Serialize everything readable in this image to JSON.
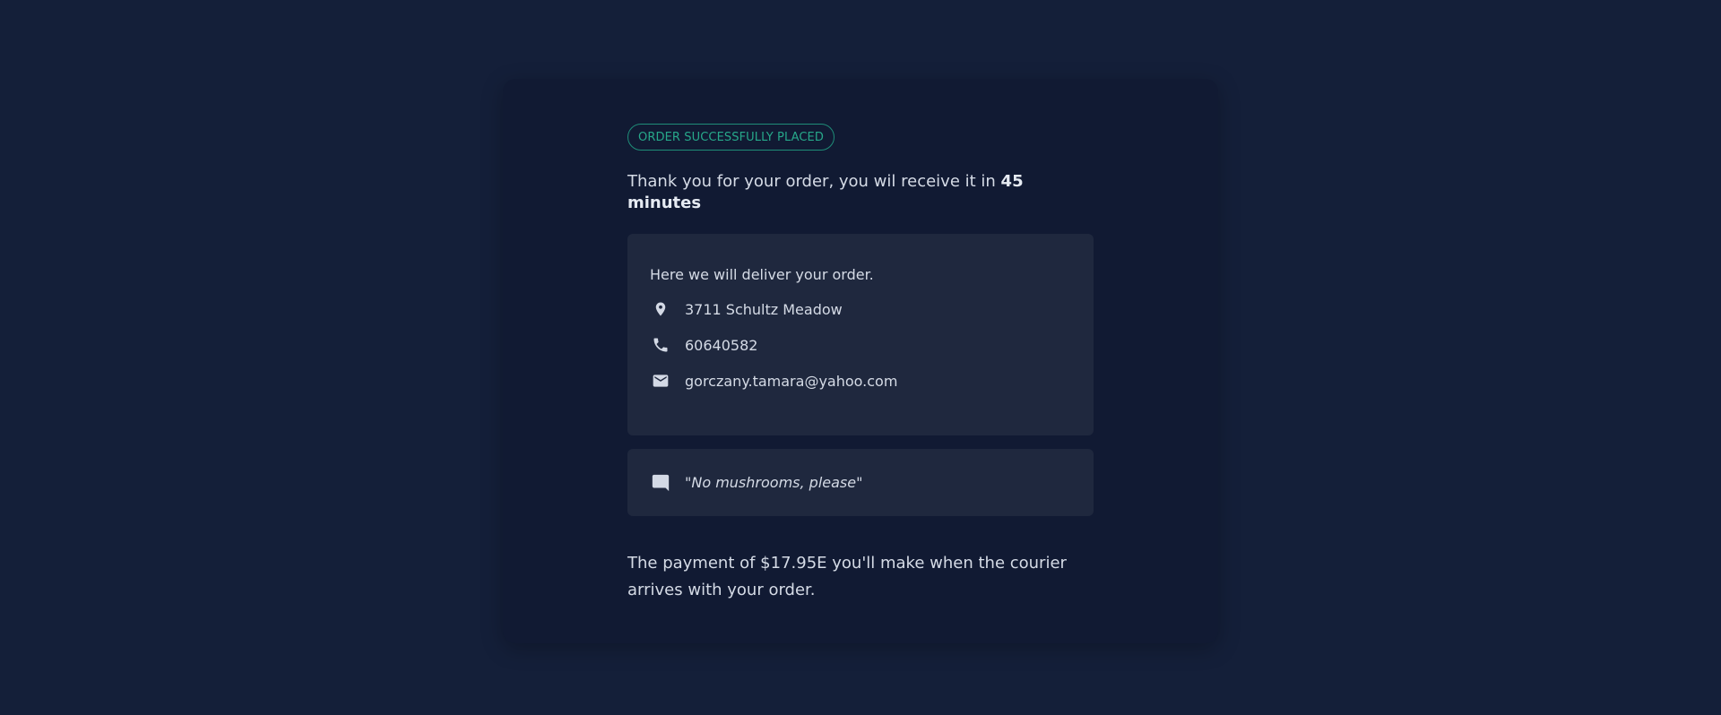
{
  "status_badge": "ORDER SUCCESSFULLY PLACED",
  "thanks": {
    "prefix": "Thank you for your order, you wil receive it in ",
    "eta": "45 minutes"
  },
  "delivery": {
    "intro": "Here we will deliver your order.",
    "address": "3711 Schultz Meadow",
    "phone": "60640582",
    "email": "gorczany.tamara@yahoo.com",
    "icons": [
      "location-pin-icon",
      "phone-icon",
      "mail-icon"
    ]
  },
  "note": {
    "text": "\"No mushrooms, please\"",
    "icon": "comment-icon"
  },
  "payment_text": "The payment of $17.95E you'll make when the courier arrives with your order.",
  "colors": {
    "background": "#141f39",
    "card": "#111a33",
    "panel": "#1f283e",
    "accent": "#27a88a",
    "text": "#d5dbe6"
  }
}
